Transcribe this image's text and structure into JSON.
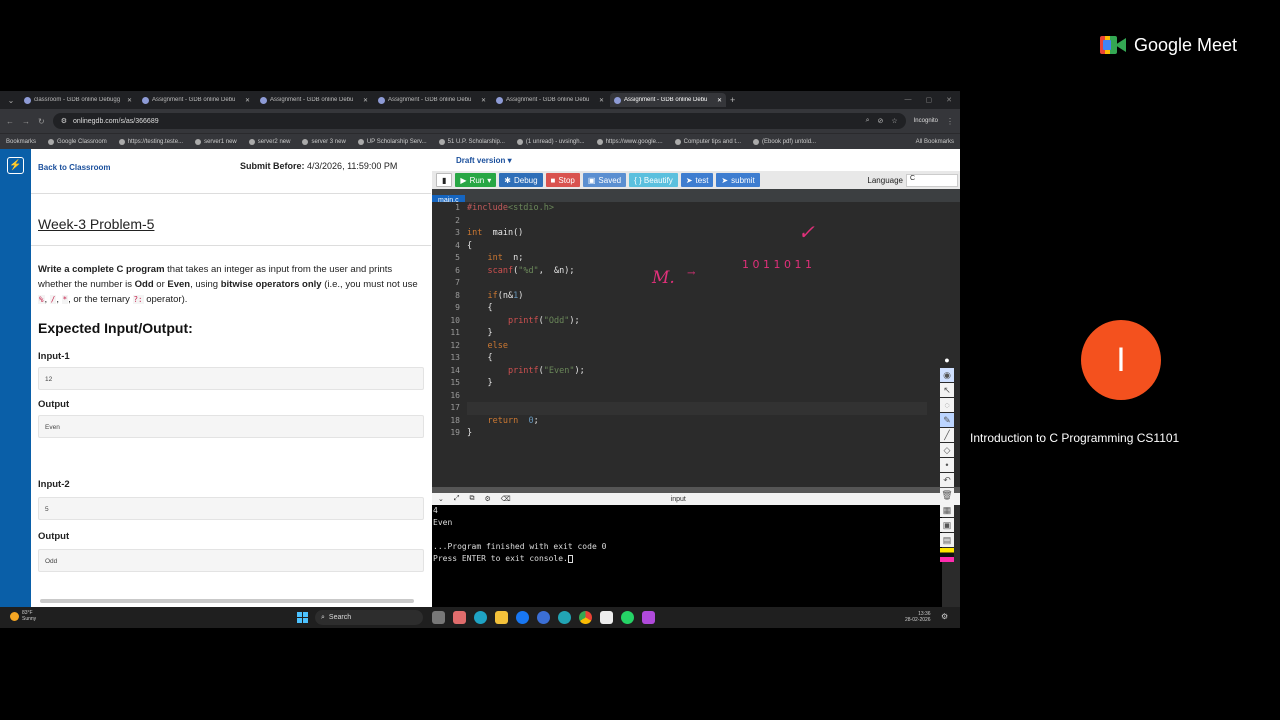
{
  "meet": {
    "brand": "Google Meet",
    "participant_initial": "I",
    "participant_label": "Introduction to C Programming CS1101",
    "avatar_color": "#f4511e"
  },
  "browser": {
    "tabs": [
      {
        "label": "classroom - GDB online Debugg",
        "active": false
      },
      {
        "label": "Assignment - GDB online Debu",
        "active": false
      },
      {
        "label": "Assignment - GDB online Debu",
        "active": false
      },
      {
        "label": "Assignment - GDB online Debu",
        "active": false
      },
      {
        "label": "Assignment - GDB online Debu",
        "active": false
      },
      {
        "label": "Assignment - GDB online Debu",
        "active": true
      }
    ],
    "url": "onlinegdb.com/s/as/366689",
    "incognito": "Incognito",
    "bookmarks": [
      "Bookmarks",
      "Google Classroom",
      "https://testing.teste...",
      "server1 new",
      "server2 new",
      "server 3 new",
      "UP Scholarship Serv...",
      "51 U.P. Scholarship...",
      "(1 unread) - uvsingh...",
      "https://www.google....",
      "Computer tips and t...",
      "(Ebook pdf) untold..."
    ],
    "all_bookmarks": "All Bookmarks"
  },
  "problem": {
    "back": "Back to Classroom",
    "submit_label": "Submit Before:",
    "submit_value": "4/3/2026, 11:59:00 PM",
    "title": "Week-3 Problem-5",
    "desc": {
      "p1": "Write a complete C program",
      "p2": " that takes an integer as input from the user and prints whether the number is ",
      "odd": "Odd",
      "p3": " or ",
      "even": "Even",
      "p4": ", using ",
      "bitwise": "bitwise operators only",
      "p5": " (i.e., you must not use ",
      "c1": "%",
      "sep1": ", ",
      "c2": "/",
      "sep2": ", ",
      "c3": "*",
      "p6": ", or the ternary ",
      "c4": "?:",
      "p7": " operator)."
    },
    "io_heading": "Expected Input/Output:",
    "input1_label": "Input-1",
    "input1_value": "12",
    "output1_label": "Output",
    "output1_value": "Even",
    "input2_label": "Input-2",
    "input2_value": "5",
    "output2_label": "Output",
    "output2_value": "Odd"
  },
  "ide": {
    "draft": "Draft version ▾",
    "buttons": {
      "run": "Run",
      "debug": "Debug",
      "stop": "Stop",
      "saved": "Saved",
      "beautify": "{ } Beautify",
      "test": "test",
      "submit": "submit"
    },
    "language_label": "Language",
    "language_value": "C",
    "file_tab": "main.c",
    "lines": [
      "1",
      "2",
      "3",
      "4",
      "5",
      "6",
      "7",
      "8",
      "9",
      "10",
      "11",
      "12",
      "13",
      "14",
      "15",
      "16",
      "17",
      "18",
      "19"
    ],
    "annotations": {
      "check": "✓",
      "m": "M.",
      "arrow": "→",
      "binary": "1 0 1 1 0 1 1"
    },
    "console_label": "input",
    "console_lines": [
      "4",
      "Even",
      "",
      "...Program finished with exit code 0",
      "Press ENTER to exit console."
    ]
  },
  "taskbar": {
    "temp": "83°F",
    "weather": "Sunny",
    "search": "Search",
    "time": "13:36",
    "date": "28-02-2026"
  }
}
